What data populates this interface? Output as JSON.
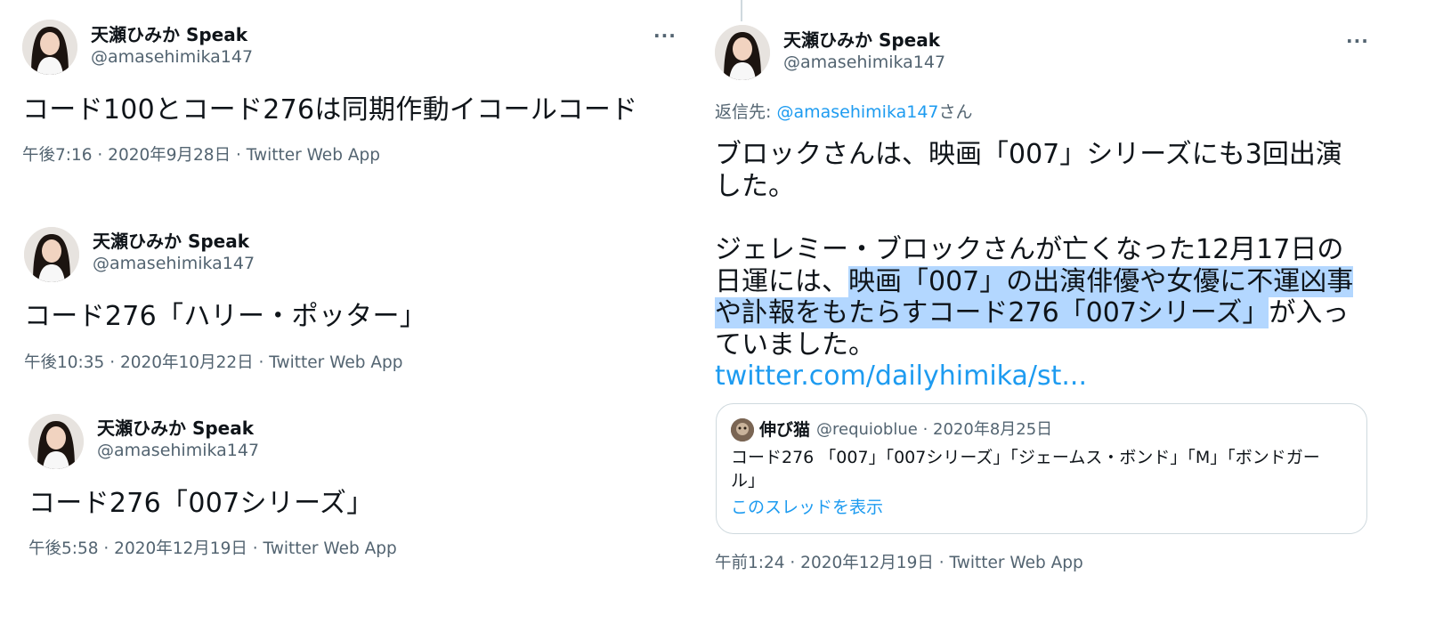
{
  "tweets": [
    {
      "name": "天瀬ひみか Speak",
      "handle": "@amasehimika147",
      "text": "コード100とコード276は同期作動イコールコード",
      "meta": "午後7:16 · 2020年9月28日 · Twitter Web App",
      "more": "···"
    },
    {
      "name": "天瀬ひみか Speak",
      "handle": "@amasehimika147",
      "text": "コード276「ハリー・ポッター」",
      "meta": "午後10:35 · 2020年10月22日 · Twitter Web App"
    },
    {
      "name": "天瀬ひみか Speak",
      "handle": "@amasehimika147",
      "text": "コード276「007シリーズ」",
      "meta": "午後5:58 · 2020年12月19日 · Twitter Web App"
    }
  ],
  "main_tweet": {
    "name": "天瀬ひみか Speak",
    "handle": "@amasehimika147",
    "more": "···",
    "reply_prefix": "返信先: ",
    "reply_handle": "@amasehimika147",
    "reply_suffix": "さん",
    "para1": "ブロックさんは、映画「007」シリーズにも3回出演した。",
    "para2_plain": "ジェレミー・ブロックさんが亡くなった12月17日の日運には、",
    "para2_highlight": "映画「007」の出演俳優や女優に不運凶事や訃報をもたらすコード276「007シリーズ」",
    "para2_rest": "が入っていました。",
    "link": "twitter.com/dailyhimika/st...",
    "quote": {
      "name": "伸び猫",
      "handle": "@requioblue",
      "date": "· 2020年8月25日",
      "text": "コード276 「007」「007シリーズ」「ジェームス・ボンド」「M」「ボンドガール」",
      "thread_link": "このスレッドを表示"
    },
    "meta": "午前1:24 · 2020年12月19日 · Twitter Web App"
  }
}
